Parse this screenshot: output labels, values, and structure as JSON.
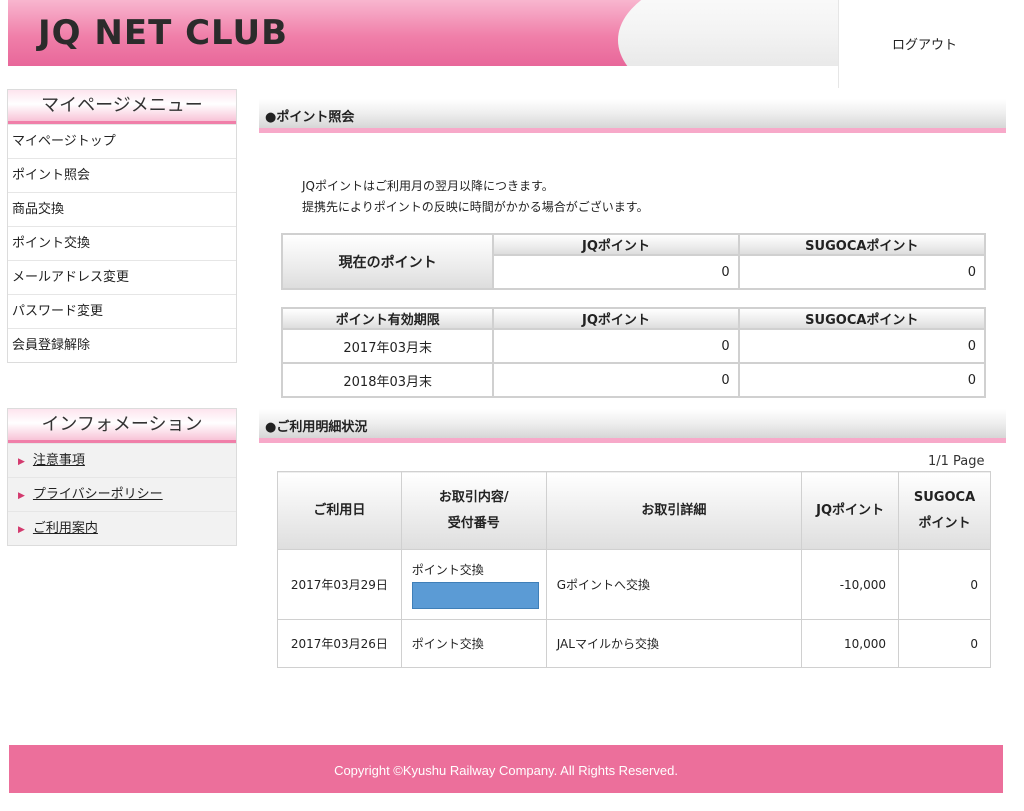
{
  "header": {
    "logo": "JQ NET CLUB",
    "logout": "ログアウト"
  },
  "sidebar": {
    "title": "マイページメニュー",
    "items": [
      {
        "label": "マイページトップ"
      },
      {
        "label": "ポイント照会"
      },
      {
        "label": "商品交換"
      },
      {
        "label": "ポイント交換"
      },
      {
        "label": "メールアドレス変更"
      },
      {
        "label": "パスワード変更"
      },
      {
        "label": "会員登録解除"
      }
    ]
  },
  "info": {
    "title": "インフォメーション",
    "items": [
      {
        "label": "注意事項"
      },
      {
        "label": "プライバシーポリシー"
      },
      {
        "label": "ご利用案内"
      }
    ]
  },
  "points_section": {
    "title": "●ポイント照会",
    "notice_line1": "JQポイントはご利用月の翌月以降につきます。",
    "notice_line2": "提携先によりポイントの反映に時間がかかる場合がございます。"
  },
  "current_points": {
    "row_label": "現在のポイント",
    "col_jq": "JQポイント",
    "col_sugoca": "SUGOCAポイント",
    "jq": "0",
    "sugoca": "0"
  },
  "expiry": {
    "col_label": "ポイント有効期限",
    "col_jq": "JQポイント",
    "col_sugoca": "SUGOCAポイント",
    "rows": [
      {
        "date": "2017年03月末",
        "jq": "0",
        "sugoca": "0"
      },
      {
        "date": "2018年03月末",
        "jq": "0",
        "sugoca": "0"
      }
    ]
  },
  "usage_section": {
    "title": "●ご利用明細状況",
    "pager": "1/1 Page",
    "headers": {
      "date": "ご利用日",
      "content_line1": "お取引内容/",
      "content_line2": "受付番号",
      "detail": "お取引詳細",
      "jq": "JQポイント",
      "sugoca_line1": "SUGOCA",
      "sugoca_line2": "ポイント"
    },
    "rows": [
      {
        "date": "2017年03月29日",
        "content": "ポイント交換",
        "detail": "Gポイントへ交換",
        "jq": "-10,000",
        "sugoca": "0"
      },
      {
        "date": "2017年03月26日",
        "content": "ポイント交換",
        "detail": "JALマイルから交換",
        "jq": "10,000",
        "sugoca": "0"
      }
    ]
  },
  "footer": {
    "copyright": "Copyright ©Kyushu Railway Company. All Rights Reserved."
  }
}
